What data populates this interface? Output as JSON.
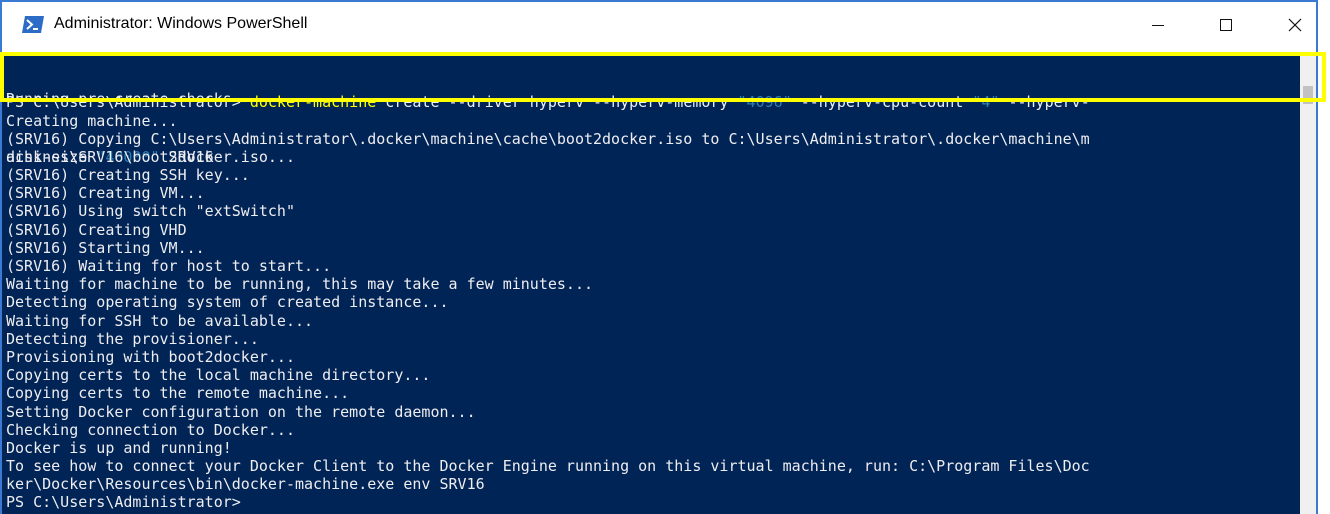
{
  "window": {
    "title": "Administrator: Windows PowerShell"
  },
  "controls": {
    "minimize": "—",
    "maximize": "☐",
    "close": "✕"
  },
  "icons": {
    "app": "powershell-icon"
  },
  "colors": {
    "console_bg": "#012456",
    "text": "#eeedf0",
    "command": "#ffff00",
    "string": "#2a7db5",
    "highlight": "#ffff00"
  },
  "console": {
    "command_line": {
      "prompt": "PS C:\\Users\\Administrator> ",
      "cmd": "docker-machine",
      "part1": " create --driver hyperv --hyperv-memory ",
      "memory": "\"4096\"",
      "part2": " --hyperv-cpu-count ",
      "cpu": "\"4\"",
      "part3": " --hyperv-",
      "part4": "disk-size ",
      "disk": "\"40000\"",
      "part5": " SRV16"
    },
    "partial_line": "Running pre-create checks...",
    "lines": [
      "Creating machine...",
      "(SRV16) Copying C:\\Users\\Administrator\\.docker\\machine\\cache\\boot2docker.iso to C:\\Users\\Administrator\\.docker\\machine\\m",
      "achines\\SRV16\\boot2docker.iso...",
      "(SRV16) Creating SSH key...",
      "(SRV16) Creating VM...",
      "(SRV16) Using switch \"extSwitch\"",
      "(SRV16) Creating VHD",
      "(SRV16) Starting VM...",
      "(SRV16) Waiting for host to start...",
      "Waiting for machine to be running, this may take a few minutes...",
      "Detecting operating system of created instance...",
      "Waiting for SSH to be available...",
      "Detecting the provisioner...",
      "Provisioning with boot2docker...",
      "Copying certs to the local machine directory...",
      "Copying certs to the remote machine...",
      "Setting Docker configuration on the remote daemon...",
      "Checking connection to Docker...",
      "Docker is up and running!",
      "To see how to connect your Docker Client to the Docker Engine running on this virtual machine, run: C:\\Program Files\\Doc",
      "ker\\Docker\\Resources\\bin\\docker-machine.exe env SRV16",
      "PS C:\\Users\\Administrator>"
    ]
  }
}
